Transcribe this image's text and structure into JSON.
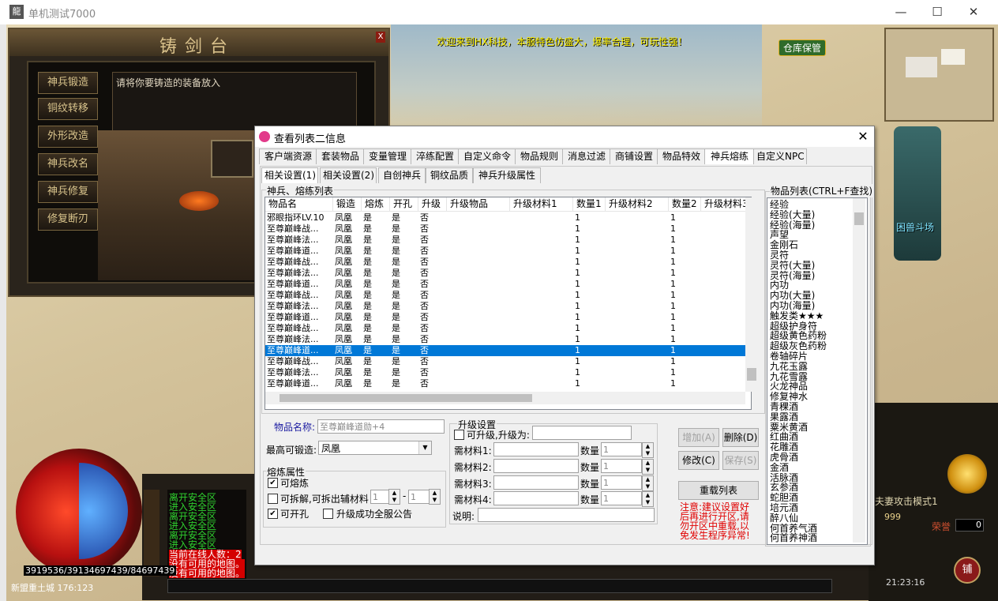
{
  "window": {
    "title": "单机测试7000",
    "minimize": "—",
    "maximize": "☐",
    "close": "✕",
    "app_icon": "龍"
  },
  "game": {
    "marquee": "欢迎来到HX科技，本服特色仿盛大，爆率合理，可玩性强！",
    "warehouse_btn": "仓库保管",
    "beast_btn": "困兽斗场",
    "forge": {
      "title": "铸剑台",
      "close": "X",
      "menu": [
        "神兵锻造",
        "铜纹转移",
        "外形改造",
        "神兵改名",
        "神兵修复",
        "修复断刃"
      ],
      "prompt": "请将你要铸造的装备放入"
    },
    "chat": [
      {
        "text": "离开安全区",
        "kind": "g"
      },
      {
        "text": "进入安全区",
        "kind": "g"
      },
      {
        "text": "离开安全区",
        "kind": "g"
      },
      {
        "text": "进入安全区",
        "kind": "g"
      },
      {
        "text": "离开安全区",
        "kind": "g"
      },
      {
        "text": "进入安全区",
        "kind": "g"
      },
      {
        "text": "当前在线人数：2",
        "kind": "r"
      },
      {
        "text": "没有可用的地图。",
        "kind": "r"
      },
      {
        "text": "没有可用的地图。",
        "kind": "r"
      }
    ],
    "stats": "3919536/39134697439/84697439",
    "location": "新盟重土城 176:123",
    "attack_mode": "夫妻攻击模式1",
    "gold": "999",
    "honor_label": "荣誉",
    "honor_value": "0",
    "clock": "21:23:16",
    "shop": "铺"
  },
  "dialog": {
    "title": "查看列表二信息",
    "close": "✕",
    "tabs": [
      "客户端资源",
      "套装物品",
      "变量管理",
      "淬练配置",
      "自定义命令",
      "物品规则",
      "消息过滤",
      "商铺设置",
      "物品特效",
      "神兵熔练",
      "自定义NPC"
    ],
    "active_tab": 9,
    "subtabs": [
      "相关设置(1)",
      "相关设置(2)",
      "自创神兵",
      "铜纹品质",
      "神兵升级属性"
    ],
    "active_subtab": 0,
    "list_group": "神兵、熔练列表",
    "columns": [
      "物品名",
      "锻造",
      "熔炼",
      "开孔",
      "升级",
      "升级物品",
      "升级材料1",
      "数量1",
      "升级材料2",
      "数量2",
      "升级材料3"
    ],
    "rows": [
      [
        "邪眼指环LV.10",
        "凤凰",
        "是",
        "是",
        "否",
        "",
        "",
        "1",
        "",
        "1",
        ""
      ],
      [
        "至尊巅峰战...",
        "凤凰",
        "是",
        "是",
        "否",
        "",
        "",
        "1",
        "",
        "1",
        ""
      ],
      [
        "至尊巅峰法...",
        "凤凰",
        "是",
        "是",
        "否",
        "",
        "",
        "1",
        "",
        "1",
        ""
      ],
      [
        "至尊巅峰道...",
        "凤凰",
        "是",
        "是",
        "否",
        "",
        "",
        "1",
        "",
        "1",
        ""
      ],
      [
        "至尊巅峰战...",
        "凤凰",
        "是",
        "是",
        "否",
        "",
        "",
        "1",
        "",
        "1",
        ""
      ],
      [
        "至尊巅峰法...",
        "凤凰",
        "是",
        "是",
        "否",
        "",
        "",
        "1",
        "",
        "1",
        ""
      ],
      [
        "至尊巅峰道...",
        "凤凰",
        "是",
        "是",
        "否",
        "",
        "",
        "1",
        "",
        "1",
        ""
      ],
      [
        "至尊巅峰战...",
        "凤凰",
        "是",
        "是",
        "否",
        "",
        "",
        "1",
        "",
        "1",
        ""
      ],
      [
        "至尊巅峰法...",
        "凤凰",
        "是",
        "是",
        "否",
        "",
        "",
        "1",
        "",
        "1",
        ""
      ],
      [
        "至尊巅峰道...",
        "凤凰",
        "是",
        "是",
        "否",
        "",
        "",
        "1",
        "",
        "1",
        ""
      ],
      [
        "至尊巅峰战...",
        "凤凰",
        "是",
        "是",
        "否",
        "",
        "",
        "1",
        "",
        "1",
        ""
      ],
      [
        "至尊巅峰法...",
        "凤凰",
        "是",
        "是",
        "否",
        "",
        "",
        "1",
        "",
        "1",
        ""
      ],
      [
        "至尊巅峰道...",
        "凤凰",
        "是",
        "是",
        "否",
        "",
        "",
        "1",
        "",
        "1",
        ""
      ],
      [
        "至尊巅峰战...",
        "凤凰",
        "是",
        "是",
        "否",
        "",
        "",
        "1",
        "",
        "1",
        ""
      ],
      [
        "至尊巅峰法...",
        "凤凰",
        "是",
        "是",
        "否",
        "",
        "",
        "1",
        "",
        "1",
        ""
      ],
      [
        "至尊巅峰道...",
        "凤凰",
        "是",
        "是",
        "否",
        "",
        "",
        "1",
        "",
        "1",
        ""
      ]
    ],
    "selected_row": 12,
    "item_list_group": "物品列表(CTRL+F查找)",
    "items": [
      "经验",
      "经验(大量)",
      "经验(海量)",
      "声望",
      "金刚石",
      "灵符",
      "灵符(大量)",
      "灵符(海量)",
      "内功",
      "内功(大量)",
      "内功(海量)",
      "触发类★★★",
      "超级护身符",
      "超级黄色药粉",
      "超级灰色药粉",
      "卷轴碎片",
      "九花玉露",
      "九花雪露",
      "火龙神品",
      "修复神水",
      "青稞酒",
      "果露酒",
      "粟米黄酒",
      "红曲酒",
      "花雕酒",
      "虎骨酒",
      "金酒",
      "活脉酒",
      "玄参酒",
      "蛇胆酒",
      "培元酒",
      "醉八仙",
      "何首养气酒",
      "何首养神酒"
    ],
    "form": {
      "item_name_label": "物品名称:",
      "item_name_value": "至尊巅峰道勋+4",
      "max_forge_label": "最高可锻造:",
      "max_forge_value": "凤凰",
      "smelt_group": "熔炼属性",
      "can_smelt": "可熔炼",
      "can_split": "可拆解,可拆出辅材料",
      "split_a": "1",
      "split_sep": "-",
      "split_b": "1",
      "can_hole": "可开孔",
      "upgrade_announce": "升级成功全服公告",
      "upgrade_group": "升级设置",
      "can_upgrade": "可升级,升级为:",
      "mat1": "需材料1:",
      "mat2": "需材料2:",
      "mat3": "需材料3:",
      "mat4": "需材料4:",
      "qty_label": "数量",
      "qty_value": "1",
      "desc_label": "说明:",
      "add_btn": "增加(A)",
      "del_btn": "删除(D)",
      "mod_btn": "修改(C)",
      "save_btn": "保存(S)",
      "reload_btn": "重载列表",
      "note": "注意:建议设置好后再进行开区,请勿开区中重载,以免发生程序异常!"
    }
  }
}
